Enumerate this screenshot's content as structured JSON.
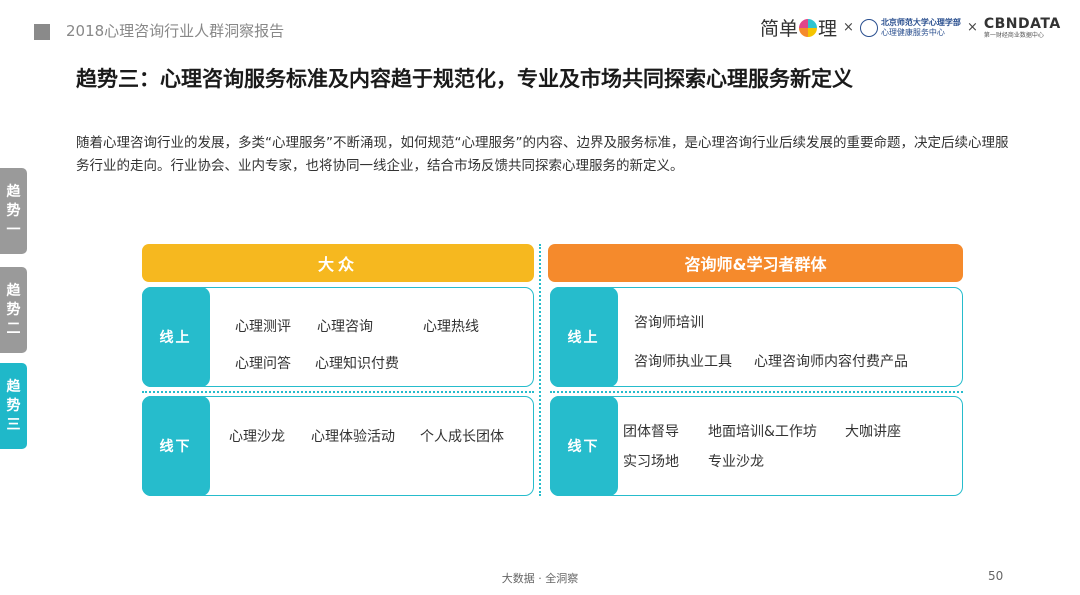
{
  "header": {
    "report_title": "2018心理咨询行业人群洞察报告",
    "logos": {
      "jiandan_left": "简单",
      "jiandan_right": "理",
      "times": "×",
      "bnu_top": "北京师范大学心理学部",
      "bnu_bottom": "心理健康服务中心",
      "cbn_main": "CBNDATA",
      "cbn_sub": "第一财经商业数据中心"
    }
  },
  "side_tabs": [
    {
      "label": "趋\n势\n一",
      "active": false
    },
    {
      "label": "趋\n势\n二",
      "active": false
    },
    {
      "label": "趋\n势\n三",
      "active": true
    }
  ],
  "title": "趋势三：心理咨询服务标准及内容趋于规范化，专业及市场共同探索心理服务新定义",
  "intro": "随着心理咨询行业的发展，多类“心理服务”不断涌现，如何规范“心理服务”的内容、边界及服务标准，是心理咨询行业后续发展的重要命题，决定后续心理服务行业的走向。行业协会、业内专家，也将协同一线企业，结合市场反馈共同探索心理服务的新定义。",
  "columns": [
    {
      "header": "大众",
      "panels": [
        {
          "label": "线上",
          "items": [
            "心理测评",
            "心理咨询",
            "心理热线",
            "心理问答",
            "心理知识付费"
          ]
        },
        {
          "label": "线下",
          "items": [
            "心理沙龙",
            "心理体验活动",
            "个人成长团体"
          ]
        }
      ]
    },
    {
      "header": "咨询师&学习者群体",
      "panels": [
        {
          "label": "线上",
          "items": [
            "咨询师培训",
            "咨询师执业工具",
            "心理咨询师内容付费产品"
          ]
        },
        {
          "label": "线下",
          "items": [
            "团体督导",
            "地面培训&工作坊",
            "大咖讲座",
            "实习场地",
            "专业沙龙"
          ]
        }
      ]
    }
  ],
  "footer": {
    "text": "大数据 · 全洞察",
    "page_number": "50"
  },
  "colors": {
    "teal": "#26bccc",
    "yellow": "#f6b81f",
    "orange": "#f58a2c",
    "gray_tab": "#9a9a9a"
  }
}
